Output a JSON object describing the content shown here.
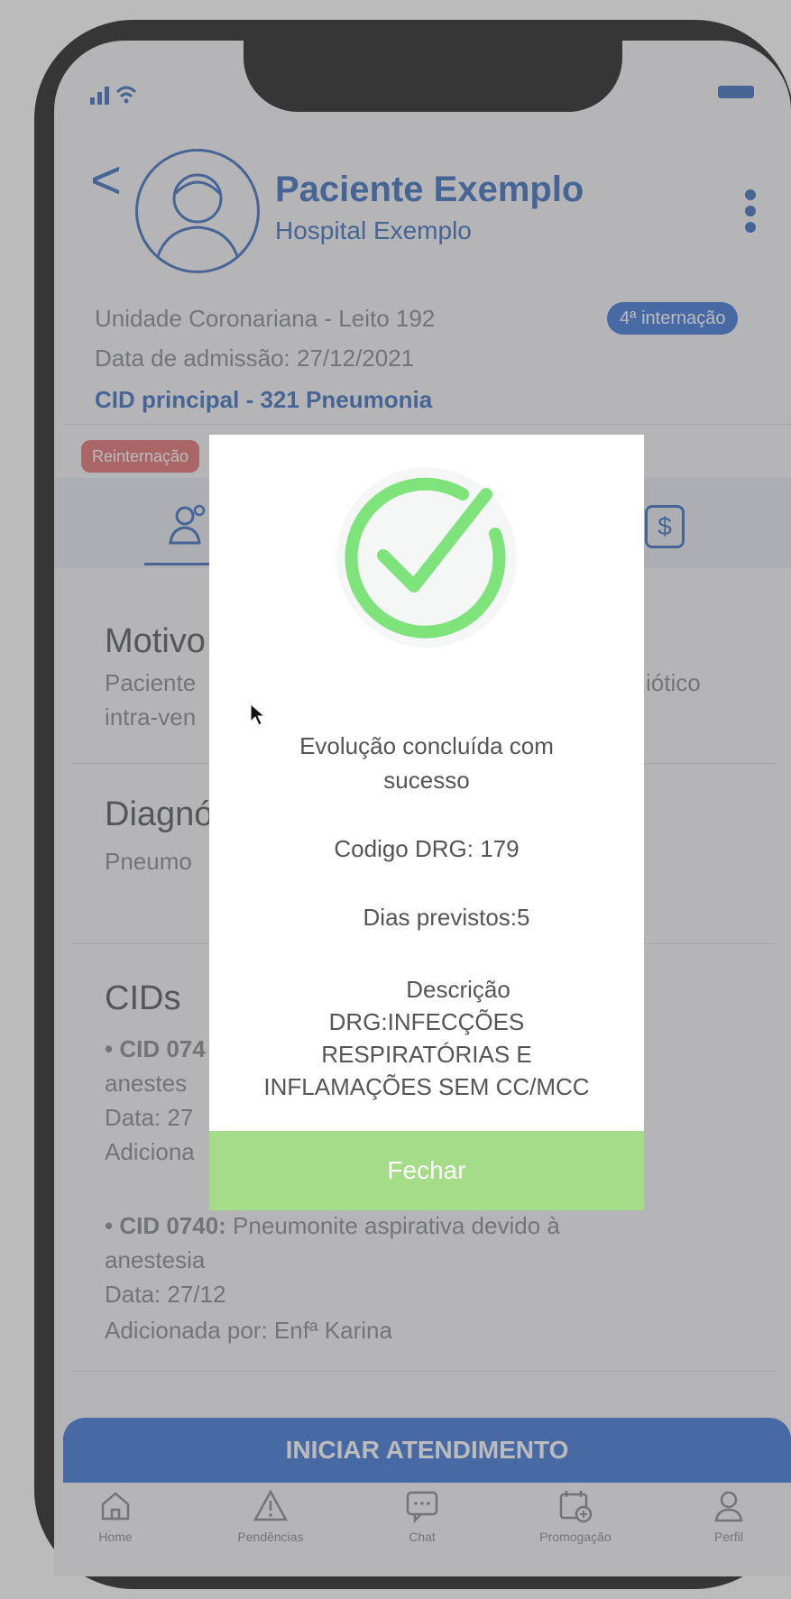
{
  "status": {
    "signal": "▂▄▆"
  },
  "header": {
    "back": "<",
    "patient_name": "Paciente Exemplo",
    "hospital": "Hospital Exemplo"
  },
  "info": {
    "unit": "Unidade Coronariana - Leito 192",
    "admission": "Data de admissão: 27/12/2021",
    "cid_principal": "CID principal - 321 Pneumonia",
    "badge": "4ª internação",
    "reinternacao": "Reinternação"
  },
  "sections": {
    "motivo_title": "Motivo",
    "motivo_text_left_1": "Paciente",
    "motivo_text_right": "iótico",
    "motivo_text_left_2": "intra-ven",
    "diagnostico_title": "Diagnó",
    "diagnostico_text": "Pneumo",
    "cids_title": "CIDs",
    "cid1_line1_bold": "• CID 074",
    "cid1_line2": "anestes",
    "cid1_line3": "Data: 27",
    "cid1_line4": "Adiciona",
    "cid2_bold": "• CID 0740:",
    "cid2_rest": " Pneumonite aspirativa devido à",
    "cid2_line2": "anestesia",
    "cid2_date": "Data: 27/12",
    "cid2_added": "Adicionada por: Enfª Karina"
  },
  "actions": {
    "start": "INICIAR ATENDIMENTO"
  },
  "nav": {
    "items": [
      {
        "label": "Home",
        "icon": "home-icon"
      },
      {
        "label": "Pendências",
        "icon": "warning-icon"
      },
      {
        "label": "Chat",
        "icon": "chat-icon"
      },
      {
        "label": "Promogação",
        "icon": "calendar-add-icon"
      },
      {
        "label": "Perfil",
        "icon": "profile-icon"
      }
    ]
  },
  "modal": {
    "line1": "Evolução concluída com",
    "line2": "sucesso",
    "drg_code": "Codigo DRG: 179",
    "days": "Dias previstos:5",
    "desc1": "Descrição",
    "desc2": "DRG:INFECÇÕES",
    "desc3": "RESPIRATÓRIAS E",
    "desc4": "INFLAMAÇÕES SEM CC/MCC",
    "close": "Fechar"
  },
  "colors": {
    "primary": "#2f6cd6",
    "success": "#7ee37a",
    "close_button": "#a5dc88",
    "badge_red": "#e06465"
  }
}
